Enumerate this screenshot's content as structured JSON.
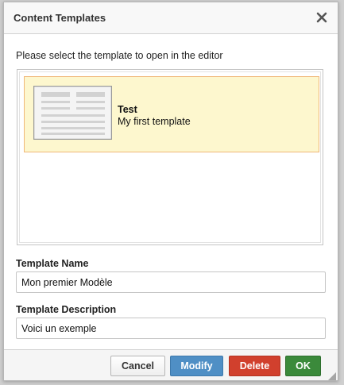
{
  "dialog": {
    "title": "Content Templates",
    "close_icon": "close-x-icon"
  },
  "instruction": "Please select the template to open in the editor",
  "templates": [
    {
      "title": "Test",
      "description": "My first template",
      "thumbnail_icon": "template-thumbnail-icon",
      "selected": true
    }
  ],
  "fields": {
    "name_label": "Template Name",
    "name_value": "Mon premier Modèle",
    "description_label": "Template Description",
    "description_value": "Voici un exemple"
  },
  "buttons": {
    "cancel": "Cancel",
    "modify": "Modify",
    "delete": "Delete",
    "ok": "OK"
  },
  "colors": {
    "selected_bg": "#fdf7ce",
    "selected_border": "#f0b878",
    "modify": "#4f8fc5",
    "delete": "#d1402d",
    "ok": "#3b8a3b"
  }
}
